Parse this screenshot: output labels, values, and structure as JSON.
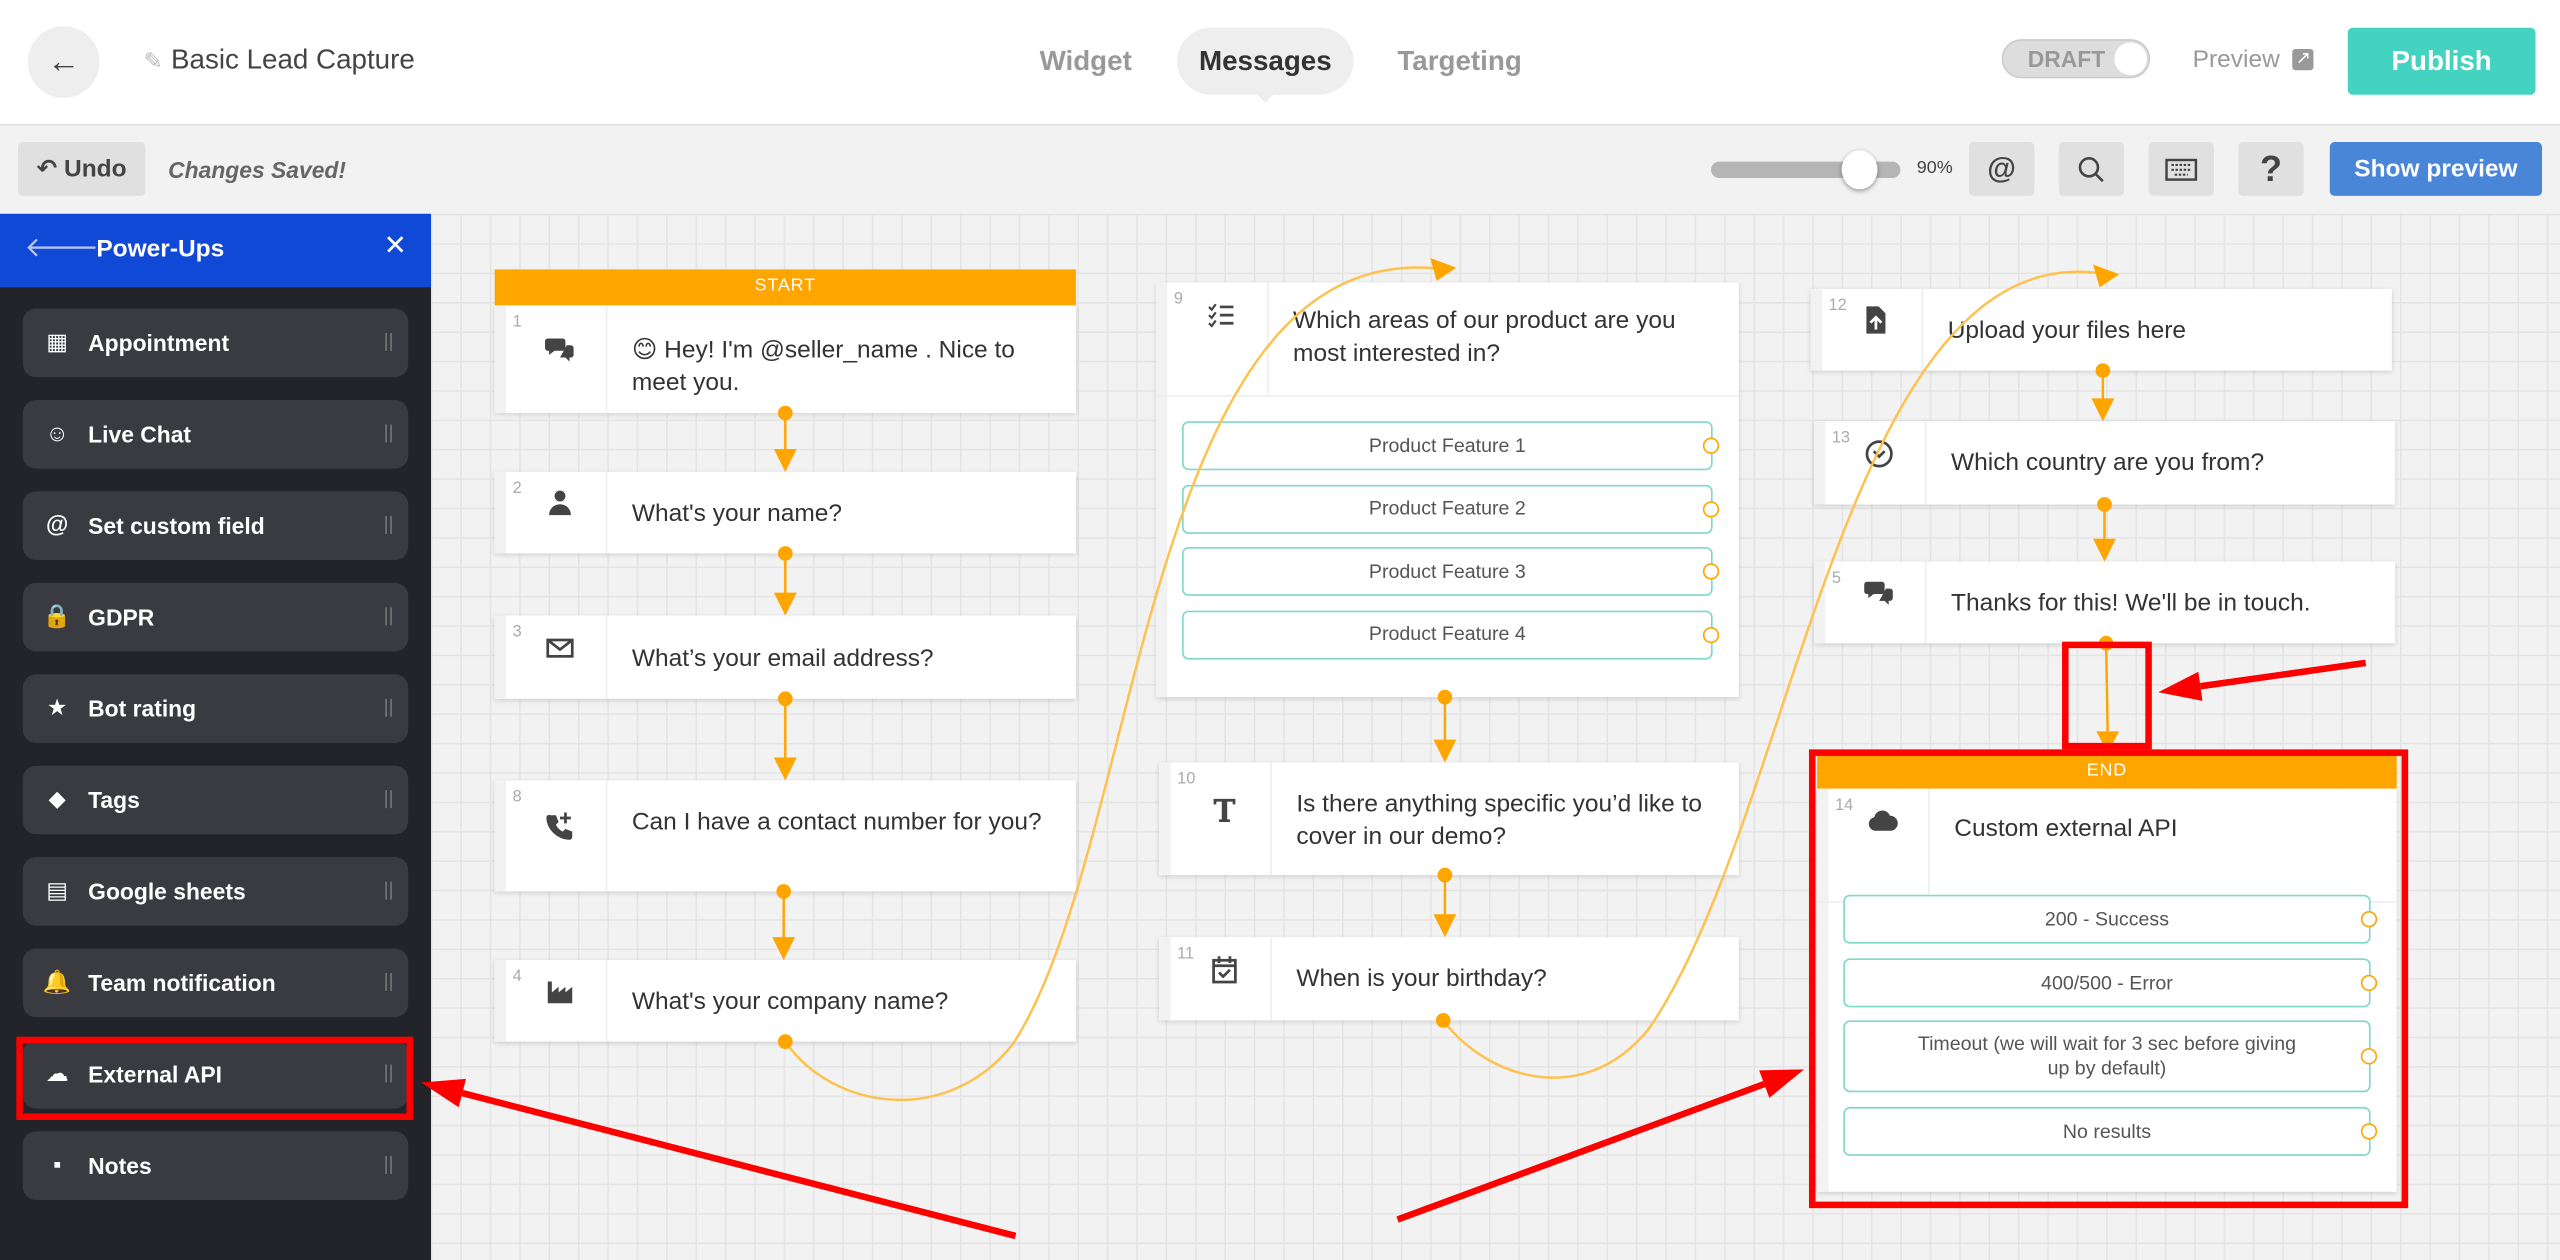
{
  "header": {
    "back_icon": "arrow-left-icon",
    "title": "Basic Lead Capture",
    "tabs": [
      {
        "label": "Widget",
        "active": false
      },
      {
        "label": "Messages",
        "active": true
      },
      {
        "label": "Targeting",
        "active": false
      }
    ],
    "status_toggle": "DRAFT",
    "preview_label": "Preview",
    "publish_label": "Publish",
    "publish_color": "#43d3c0"
  },
  "toolbar": {
    "undo_label": "Undo",
    "status_text": "Changes Saved!",
    "zoom_percent": 90,
    "zoom_label": "90%",
    "buttons": [
      "at-icon",
      "search-icon",
      "keyboard-icon",
      "help-icon"
    ],
    "help_label": "?",
    "at_label": "@",
    "show_preview_label": "Show preview",
    "show_preview_color": "#4a86d8"
  },
  "sidebar": {
    "title": "Power-Ups",
    "header_color": "#1049d6",
    "items": [
      {
        "label": "Appointment",
        "icon": "calendar-icon"
      },
      {
        "label": "Live Chat",
        "icon": "chat-smile-icon"
      },
      {
        "label": "Set custom field",
        "icon": "at-icon"
      },
      {
        "label": "GDPR",
        "icon": "lock-icon"
      },
      {
        "label": "Bot rating",
        "icon": "star-icon"
      },
      {
        "label": "Tags",
        "icon": "tag-icon"
      },
      {
        "label": "Google sheets",
        "icon": "sheet-icon"
      },
      {
        "label": "Team notification",
        "icon": "bell-icon"
      },
      {
        "label": "External API",
        "icon": "cloud-icon",
        "highlighted": true
      },
      {
        "label": "Notes",
        "icon": "note-icon"
      }
    ]
  },
  "canvas": {
    "start_label": "START",
    "end_label": "END",
    "accent": "#ffa500",
    "nodes": [
      {
        "num": "1",
        "icon": "chat-icon",
        "text": "😊 Hey! I'm @seller_name . Nice to meet you."
      },
      {
        "num": "2",
        "icon": "user-icon",
        "text": "What's your name?"
      },
      {
        "num": "3",
        "icon": "envelope-icon",
        "text": "What’s your email address?"
      },
      {
        "num": "8",
        "icon": "phone-plus-icon",
        "text": "Can I have a contact number for you?"
      },
      {
        "num": "4",
        "icon": "factory-icon",
        "text": "What's your company name?"
      },
      {
        "num": "9",
        "icon": "checklist-icon",
        "text": "Which areas of our product are you most interested in?",
        "options": [
          "Product Feature 1",
          "Product Feature 2",
          "Product Feature 3",
          "Product Feature 4"
        ]
      },
      {
        "num": "10",
        "icon": "text-icon",
        "text": "Is there anything specific you’d like to cover in our demo?"
      },
      {
        "num": "11",
        "icon": "calendar-check-icon",
        "text": "When is your birthday?"
      },
      {
        "num": "12",
        "icon": "file-upload-icon",
        "text": "Upload your files here"
      },
      {
        "num": "13",
        "icon": "chevron-circle-icon",
        "text": "Which country are you from?"
      },
      {
        "num": "5",
        "icon": "chat-icon",
        "text": "Thanks for this! We'll be in touch."
      },
      {
        "num": "14",
        "icon": "cloud-icon",
        "text": "Custom external API",
        "options": [
          "200 - Success",
          "400/500 - Error",
          "Timeout (we will wait for 3 sec before giving up by default)",
          "No results"
        ]
      }
    ]
  },
  "annotation_color": "#ff0000"
}
